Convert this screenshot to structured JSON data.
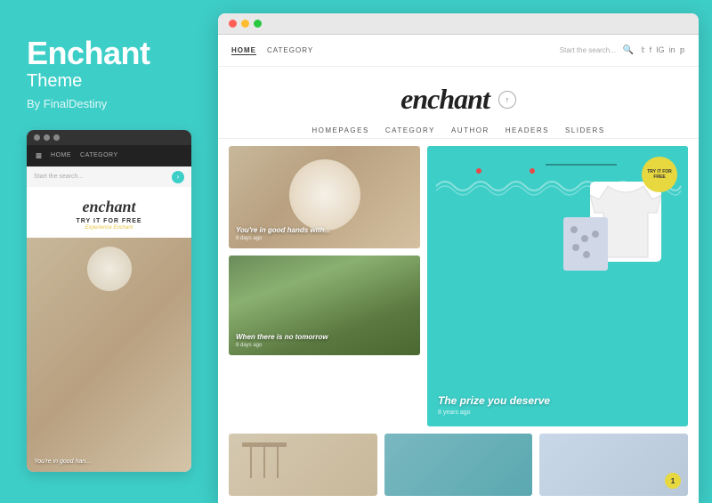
{
  "left": {
    "title": "Enchant",
    "subtitle": "Theme",
    "author": "By FinalDestiny",
    "mini_nav": {
      "home": "HOME",
      "category": "CATEGORY"
    },
    "mini_search_placeholder": "Start the search...",
    "mini_logo": "enchant",
    "mini_try": "TRY IT FOR FREE",
    "mini_experience": "Experience Enchant",
    "mini_post_caption": "You're in good han..."
  },
  "browser": {
    "dots": [
      "red",
      "yellow",
      "green"
    ]
  },
  "site": {
    "nav": {
      "home": "HOME",
      "category": "CATEGORY",
      "search_placeholder": "Start the search...",
      "social": [
        "t",
        "f",
        "in",
        "📌"
      ]
    },
    "logo": "enchant",
    "logo_badge": "↑",
    "menu": [
      "HOMEPAGES",
      "CATEGORY",
      "AUTHOR",
      "HEADERS",
      "SLIDERS"
    ],
    "posts": [
      {
        "title": "You're in good hands with...",
        "date": "8 days ago"
      },
      {
        "title": "When there is no tomorrow",
        "date": "8 days ago"
      },
      {
        "title": "The prize you deserve",
        "date": "8 years ago",
        "try_label": "TRY IT FOR FREE",
        "experience_label": "Experience Enchant"
      }
    ],
    "bottom_posts": [
      {
        "id": 1
      },
      {
        "id": 2
      },
      {
        "id": 3,
        "badge": "1"
      }
    ]
  }
}
